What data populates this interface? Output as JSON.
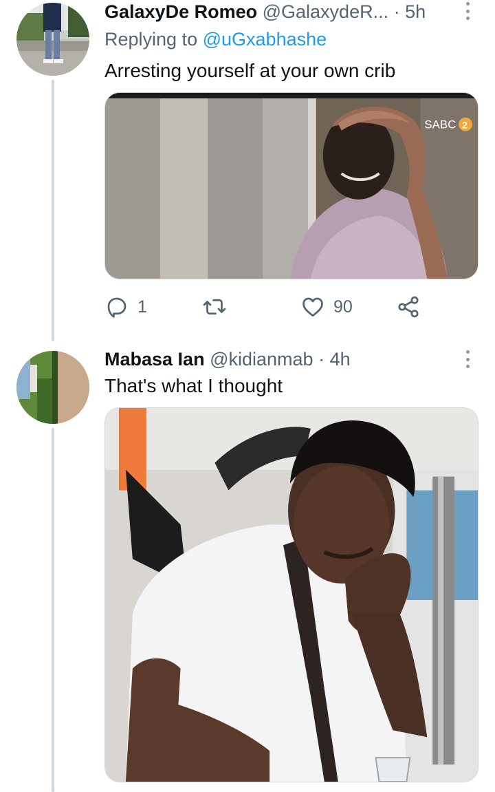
{
  "tweets": [
    {
      "name": "GalaxyDe Romeo",
      "handle": "@GalaxydeR...",
      "separator": "·",
      "time": "5h",
      "reply_prefix": "Replying to",
      "reply_mention": "@uGxabhashe",
      "text": "Arresting yourself at your own crib",
      "media_watermark": "SABC",
      "media_watermark_number": "2",
      "actions": {
        "reply_count": "1",
        "retweet_count": "",
        "like_count": "90"
      }
    },
    {
      "name": "Mabasa Ian",
      "handle": "@kidianmab",
      "separator": "·",
      "time": "4h",
      "text": "That's what I thought"
    }
  ],
  "icons": {
    "reply": "reply-icon",
    "retweet": "retweet-icon",
    "like": "heart-icon",
    "share": "share-icon",
    "more": "more-vertical-icon"
  },
  "colors": {
    "name": "#0f1419",
    "secondary": "#536471",
    "link": "#1d9bf0",
    "thread_line": "#cfd9de"
  }
}
